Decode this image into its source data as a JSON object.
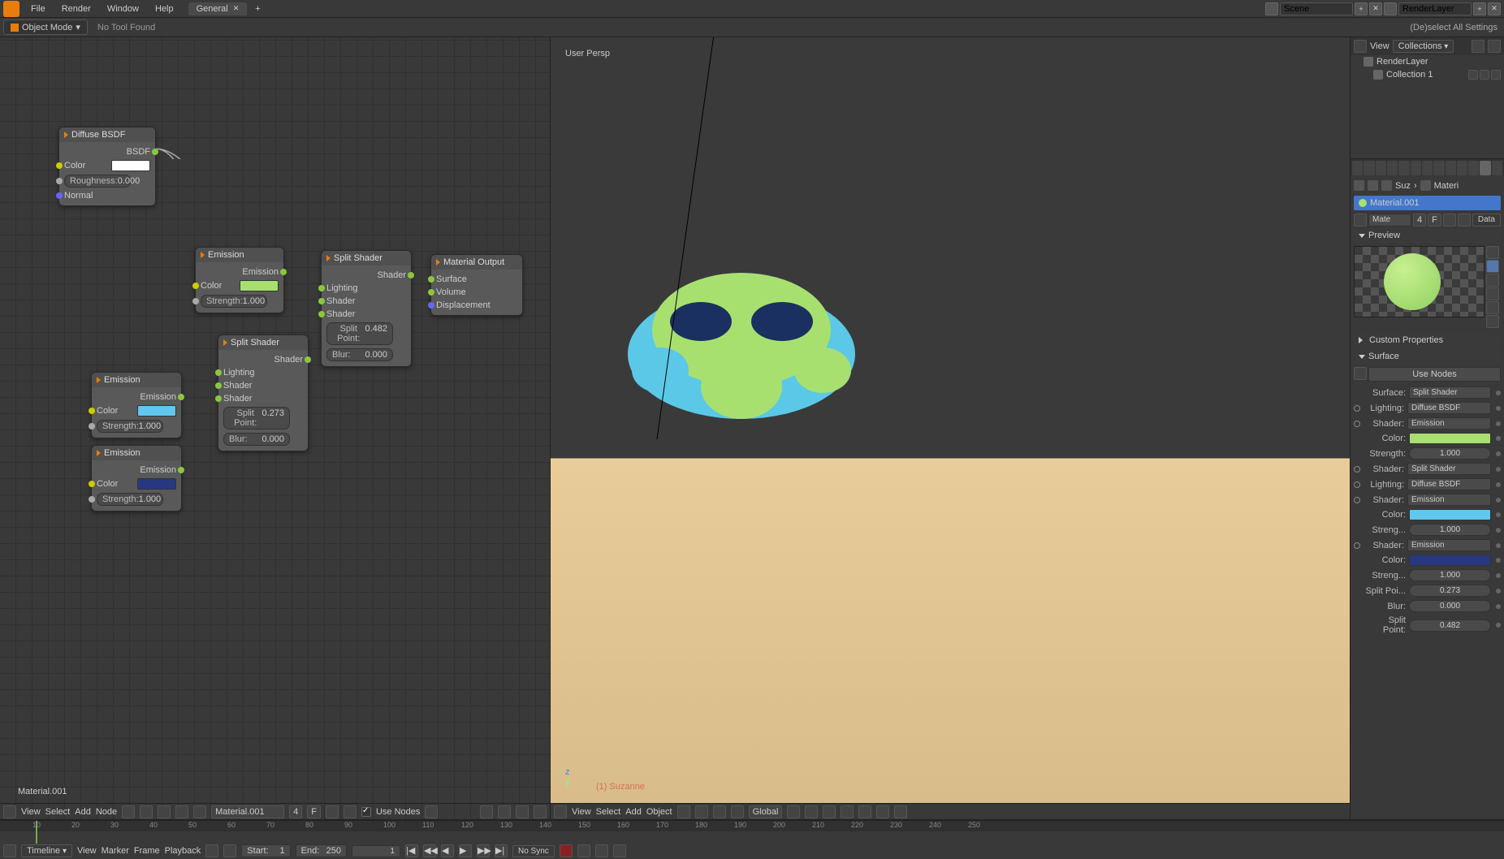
{
  "menus": {
    "file": "File",
    "render": "Render",
    "window": "Window",
    "help": "Help"
  },
  "workspace_tab": "General",
  "scene_field": "Scene",
  "layer_field": "RenderLayer",
  "mode": "Object Mode",
  "no_tool": "No Tool Found",
  "deselect": "(De)select All Settings",
  "viewport": {
    "persp": "User Persp",
    "suzanne": "(1) Suzanne",
    "view": "View",
    "select": "Select",
    "add": "Add",
    "object": "Object",
    "global": "Global"
  },
  "node_editor": {
    "material_label": "Material.001",
    "footer": {
      "view": "View",
      "select": "Select",
      "add": "Add",
      "node": "Node",
      "mat": "Material.001",
      "frame": "4",
      "f": "F",
      "use_nodes": "Use Nodes"
    }
  },
  "nodes": {
    "diffuse": {
      "title": "Diffuse BSDF",
      "out": "BSDF",
      "color": "Color",
      "roughness": "Roughness:",
      "roughness_v": "0.000",
      "normal": "Normal",
      "swatch": "#ffffff"
    },
    "emission1": {
      "title": "Emission",
      "out": "Emission",
      "color": "Color",
      "strength": "Strength:",
      "strength_v": "1.000",
      "swatch": "#a8e070"
    },
    "emission2": {
      "title": "Emission",
      "out": "Emission",
      "color": "Color",
      "strength": "Strength:",
      "strength_v": "1.000",
      "swatch": "#60c8f0"
    },
    "emission3": {
      "title": "Emission",
      "out": "Emission",
      "color": "Color",
      "strength": "Strength:",
      "strength_v": "1.000",
      "swatch": "#283880"
    },
    "split1": {
      "title": "Split Shader",
      "out": "Shader",
      "lighting": "Lighting",
      "shader1": "Shader",
      "shader2": "Shader",
      "sp": "Split Point:",
      "sp_v": "0.273",
      "blur": "Blur:",
      "blur_v": "0.000"
    },
    "split2": {
      "title": "Split Shader",
      "out": "Shader",
      "lighting": "Lighting",
      "shader1": "Shader",
      "shader2": "Shader",
      "sp": "Split Point:",
      "sp_v": "0.482",
      "blur": "Blur:",
      "blur_v": "0.000"
    },
    "output": {
      "title": "Material Output",
      "surface": "Surface",
      "volume": "Volume",
      "disp": "Displacement"
    }
  },
  "outliner": {
    "view": "View",
    "collections": "Collections",
    "items": [
      "RenderLayer",
      "Collection 1"
    ]
  },
  "props": {
    "suz": "Suz",
    "mat_short": "Materi",
    "mate": "Mate",
    "four": "4",
    "f": "F",
    "data": "Data",
    "material": "Material.001",
    "preview": "Preview",
    "custom": "Custom Properties",
    "surface": "Surface",
    "use_nodes": "Use Nodes",
    "rows": [
      {
        "label": "Surface:",
        "type": "drop",
        "value": "Split Shader"
      },
      {
        "label": "Lighting:",
        "type": "drop",
        "value": "Diffuse BSDF",
        "dot": true
      },
      {
        "label": "Shader:",
        "type": "drop",
        "value": "Emission",
        "dot": true
      },
      {
        "label": "Color:",
        "type": "color",
        "value": "#a8e070"
      },
      {
        "label": "Strength:",
        "type": "num",
        "value": "1.000"
      },
      {
        "label": "Shader:",
        "type": "drop",
        "value": "Split Shader",
        "dot": true
      },
      {
        "label": "Lighting:",
        "type": "drop",
        "value": "Diffuse BSDF",
        "dot": true
      },
      {
        "label": "Shader:",
        "type": "drop",
        "value": "Emission",
        "dot": true
      },
      {
        "label": "Color:",
        "type": "color",
        "value": "#60c8f0"
      },
      {
        "label": "Streng...",
        "type": "num",
        "value": "1.000"
      },
      {
        "label": "Shader:",
        "type": "drop",
        "value": "Emission",
        "dot": true
      },
      {
        "label": "Color:",
        "type": "color",
        "value": "#283880"
      },
      {
        "label": "Streng...",
        "type": "num",
        "value": "1.000"
      },
      {
        "label": "Split Poi...",
        "type": "num",
        "value": "0.273"
      },
      {
        "label": "Blur:",
        "type": "num",
        "value": "0.000"
      },
      {
        "label": "Split Point:",
        "type": "num",
        "value": "0.482"
      }
    ]
  },
  "timeline": {
    "label": "Timeline",
    "view": "View",
    "marker": "Marker",
    "frame": "Frame",
    "playback": "Playback",
    "start": "Start:",
    "start_v": "1",
    "end": "End:",
    "end_v": "250",
    "current": "1",
    "sync": "No Sync",
    "ticks": [
      10,
      20,
      30,
      40,
      50,
      60,
      70,
      80,
      90,
      100,
      110,
      120,
      130,
      140,
      150,
      160,
      170,
      180,
      190,
      200,
      210,
      220,
      230,
      240,
      250
    ]
  }
}
